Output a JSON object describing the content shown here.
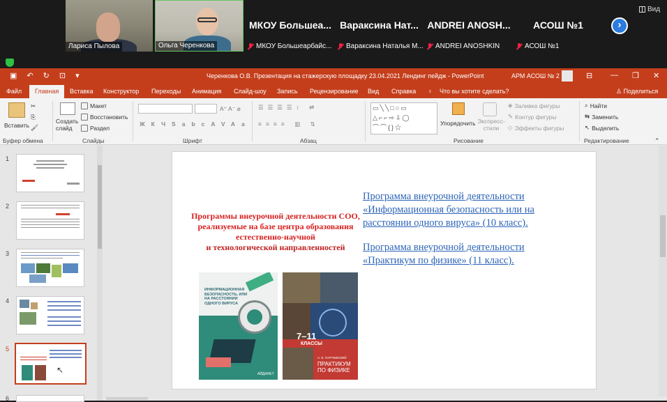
{
  "conference": {
    "view_label": "Вид",
    "participants": [
      {
        "caption": "Лариса Пылова"
      },
      {
        "caption": "Ольга Черенкова"
      },
      {
        "big_name": "МКОУ  Большеа...",
        "caption": "МКОУ Большеарбайс..."
      },
      {
        "big_name": "Вараксина  Нат...",
        "caption": "Вараксина Наталья М..."
      },
      {
        "big_name": "ANDREI  ANOSH...",
        "caption": "ANDREI ANOSHKIN"
      },
      {
        "big_name": "АСОШ №1",
        "caption": "АСОШ №1"
      }
    ],
    "next_glyph": "›"
  },
  "powerpoint": {
    "title": "Черенкова О.В. Презентация на стажерскую площадку 23.04.2021 Лендинг пейдж  -  PowerPoint",
    "account": "АРМ АСОШ № 2",
    "tabs": [
      "Файл",
      "Главная",
      "Вставка",
      "Конструктор",
      "Переходы",
      "Анимация",
      "Слайд-шоу",
      "Запись",
      "Рецензирование",
      "Вид",
      "Справка"
    ],
    "tell_me": "Что вы хотите сделать?",
    "share": "Поделиться",
    "ribbon": {
      "paste": "Вставить",
      "clipboard_group": "Буфер обмена",
      "new_slide": "Создать слайд",
      "layout": "Макет",
      "reset": "Восстановить",
      "section": "Раздел",
      "slides_group": "Слайды",
      "font_group": "Шрифт",
      "paragraph_group": "Абзац",
      "arrange": "Упорядочить",
      "quick_styles": "Экспресс-стили",
      "shape_fill": "Заливка фигуры",
      "shape_outline": "Контур фигуры",
      "shape_effects": "Эффекты фигуры",
      "drawing_group": "Рисование",
      "find": "Найти",
      "replace": "Заменить",
      "select": "Выделить",
      "editing_group": "Редактирование"
    },
    "thumbnails": [
      {
        "num": "1"
      },
      {
        "num": "2"
      },
      {
        "num": "3"
      },
      {
        "num": "4"
      },
      {
        "num": "5"
      },
      {
        "num": "6"
      }
    ],
    "slide": {
      "red_line1": "Программы внеурочной деятельности СОО,",
      "red_line2": "реализуемые на базе центра образования",
      "red_line3": "естественно-научной",
      "red_line4": "и технологической направленностей",
      "link1_line1": "Программа внеурочной деятельности",
      "link1_line2": "«Информационная безопасность или на",
      "link1_line3": "расстоянии одного вируса» (10 класс).",
      "link2_line1": "Программа внеурочной деятельности",
      "link2_line2": "«Практикум по физике» (11 класс).",
      "book1_title": "ИНФОРМАЦИОННАЯ БЕЗОПАСНОСТЬ, ИЛИ НА РАССТОЯНИИ ОДНОГО ВИРУСА",
      "book1_publisher": "АЙДАНЕТ",
      "book2_grades": "7–11",
      "book2_classes": "КЛАССЫ",
      "book2_author": "А. Е. ПАРЧЕВСКИЙ",
      "book2_title1": "ПРАКТИКУМ",
      "book2_title2": "ПО ФИЗИКЕ"
    }
  }
}
